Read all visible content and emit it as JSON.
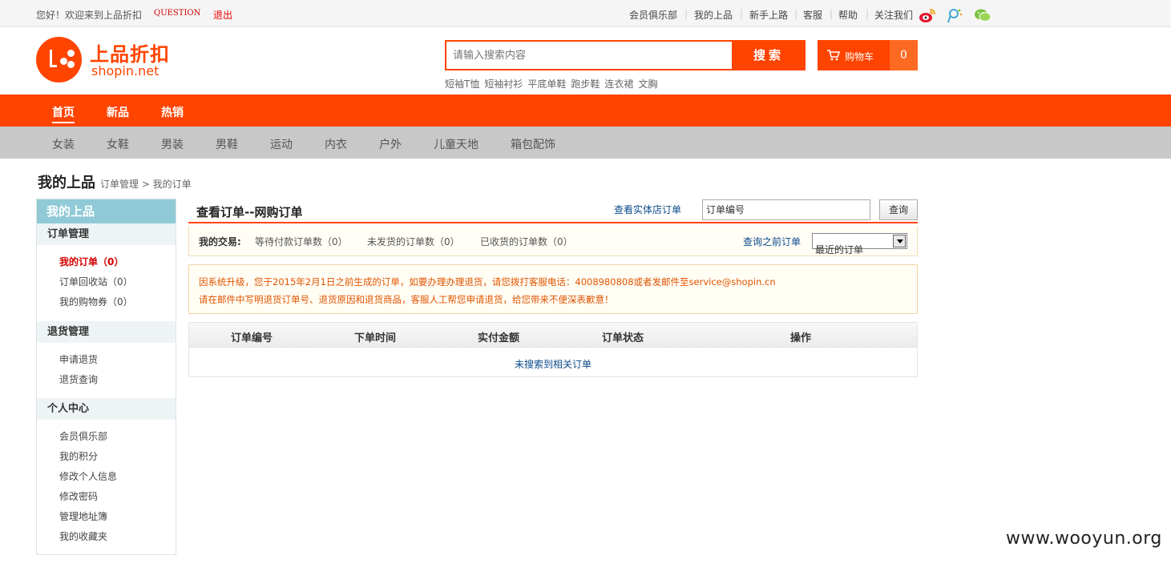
{
  "topbar": {
    "greeting": "您好！欢迎来到上品折扣",
    "question": "QUESTION",
    "logout": "退出",
    "links": [
      "会员俱乐部",
      "我的上品",
      "新手上路",
      "客服",
      "帮助",
      "关注我们"
    ]
  },
  "header": {
    "brand_cn": "上品折扣",
    "brand_en": "shopin.net",
    "search_placeholder": "请输入搜索内容",
    "search_button": "搜索",
    "hotwords": [
      "短袖T恤",
      "短袖衬衫",
      "平底单鞋",
      "跑步鞋",
      "连衣裙",
      "文胸"
    ],
    "cart_label": "购物车",
    "cart_count": "0"
  },
  "mainnav": [
    "首页",
    "新品",
    "热销"
  ],
  "subnav": [
    "女装",
    "女鞋",
    "男装",
    "男鞋",
    "运动",
    "内衣",
    "户外",
    "儿童天地",
    "箱包配饰"
  ],
  "breadcrumb": {
    "title": "我的上品",
    "path": "订单管理 > 我的订单"
  },
  "sidebar": {
    "header": "我的上品",
    "groups": [
      {
        "title": "订单管理",
        "items": [
          "我的订单（0）",
          "订单回收站（0）",
          "我的购物券（0）"
        ]
      },
      {
        "title": "退货管理",
        "items": [
          "申请退货",
          "退货查询"
        ]
      },
      {
        "title": "个人中心",
        "items": [
          "会员俱乐部",
          "我的积分",
          "修改个人信息",
          "修改密码",
          "管理地址簿",
          "我的收藏夹"
        ]
      }
    ]
  },
  "main": {
    "tab_title": "查看订单--网购订单",
    "store_link": "查看实体店订单",
    "order_input_value": "订单编号",
    "query_button": "查询",
    "trade_label": "我的交易:",
    "stats": [
      "等待付款订单数（0）",
      "未发货的订单数（0）",
      "已收货的订单数（0）"
    ],
    "prev_link": "查询之前订单",
    "select_value": "最近的订单",
    "notice_line1": "因系统升级，您于2015年2月1日之前生成的订单，如要办理办理退货，请您拨打客服电话：4008980808或者发邮件至service@shopin.cn",
    "notice_line2": "请在邮件中写明退货订单号、退货原因和退货商品，客服人工帮您申请退货，给您带来不便深表歉意！",
    "table_headers": [
      "订单编号",
      "下单时间",
      "实付金额",
      "订单状态",
      "操作"
    ],
    "empty_text": "未搜索到相关订单"
  },
  "watermark": "www.wooyun.org",
  "colors": {
    "brand": "#ff4400",
    "link": "#0b4a8a",
    "sidebar_head": "#8fcad6"
  }
}
